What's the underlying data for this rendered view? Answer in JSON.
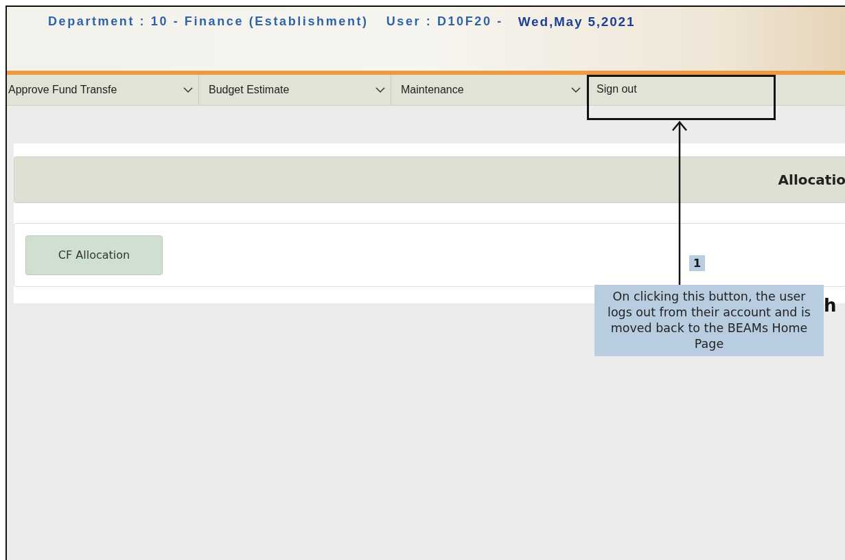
{
  "header": {
    "department": "Department : 10 - Finance (Establishment)",
    "user": "User : D10F20 -",
    "date": "Wed,May 5,2021"
  },
  "menu": [
    {
      "label": "Approve Fund Transfe",
      "dropdown": true,
      "highlighted": false
    },
    {
      "label": "Budget Estimate",
      "dropdown": true,
      "highlighted": false
    },
    {
      "label": "Maintenance",
      "dropdown": true,
      "highlighted": false
    },
    {
      "label": "Sign out",
      "dropdown": false,
      "highlighted": true
    }
  ],
  "panel": {
    "title": "Allocatio",
    "buttons": [
      "CF Allocation"
    ],
    "cut_text": "h"
  },
  "annotation": {
    "number": "1",
    "text": "On clicking this button, the user logs out from their account and is moved back to the BEAMs Home Page"
  }
}
